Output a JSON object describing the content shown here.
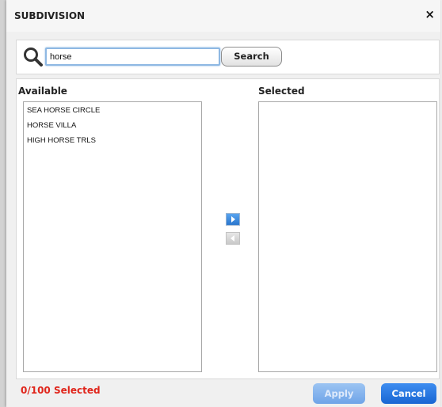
{
  "dialog": {
    "title": "SUBDIVISION",
    "close_label": "×"
  },
  "search": {
    "value": "horse",
    "button_label": "Search",
    "icon": "magnifier-icon"
  },
  "available": {
    "label": "Available",
    "items": [
      "SEA HORSE CIRCLE",
      "HORSE VILLA",
      "HIGH HORSE TRLS"
    ]
  },
  "selected": {
    "label": "Selected",
    "items": []
  },
  "transfer": {
    "add_icon": "arrow-right-icon",
    "remove_icon": "arrow-left-icon"
  },
  "footer": {
    "count_text": "0/100 Selected",
    "apply_label": "Apply",
    "cancel_label": "Cancel"
  },
  "colors": {
    "accent": "#1f6fd6",
    "count_red": "#e0251b",
    "apply_disabled": "#8fb8ee"
  }
}
